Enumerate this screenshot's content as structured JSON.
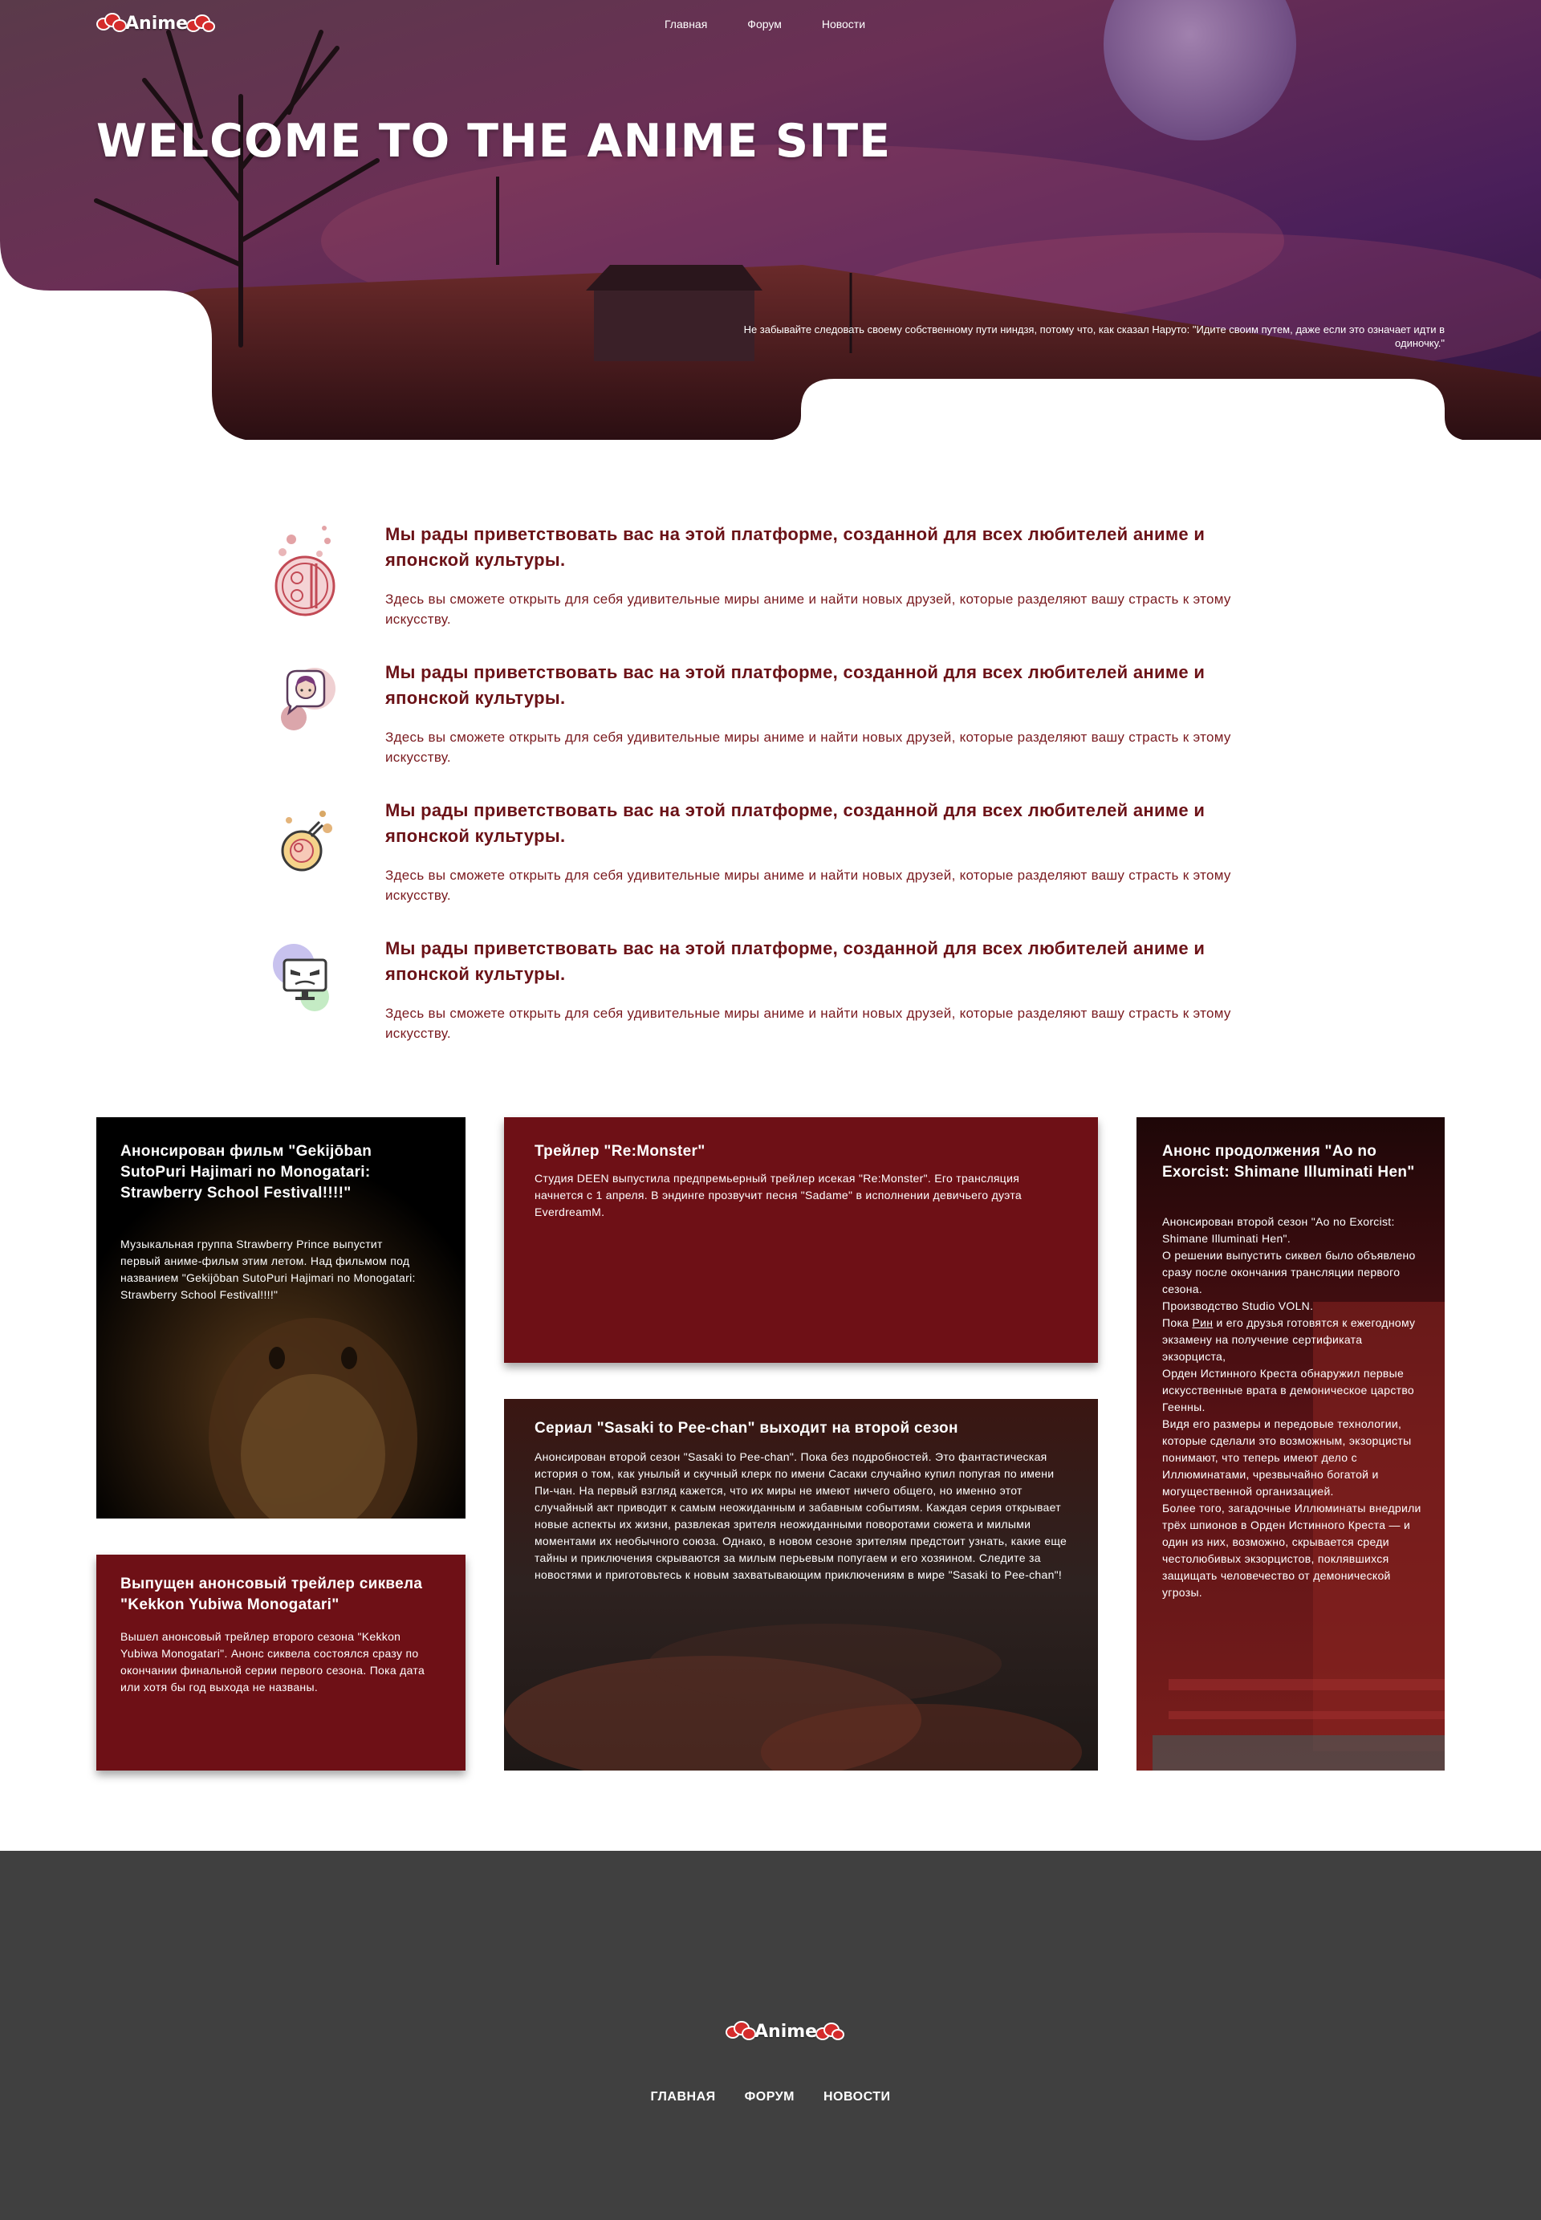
{
  "header": {
    "logo_text": "Anime",
    "nav": [
      "Главная",
      "Форум",
      "Новости"
    ]
  },
  "hero": {
    "title": "WELCOME TO THE ANIME SITE",
    "quote": "Не забывайте следовать своему собственному пути ниндзя, потому что, как сказал Наруто: \"Идите своим путем, даже если это означает идти в одиночку.\""
  },
  "features": [
    {
      "icon": "ramen-bowl-icon",
      "title": "Мы рады приветствовать вас на этой платформе, созданной для всех любителей аниме и японской культуры.",
      "text": "Здесь вы сможете открыть для себя удивительные миры аниме и найти новых друзей, которые разделяют вашу страсть к этому искусству."
    },
    {
      "icon": "anime-girl-chat-icon",
      "title": "Мы рады приветствовать вас на этой платформе, созданной для всех любителей аниме и японской культуры.",
      "text": "Здесь вы сможете открыть для себя удивительные миры аниме и найти новых друзей, которые разделяют вашу страсть к этому искусству."
    },
    {
      "icon": "noodle-cup-icon",
      "title": "Мы рады приветствовать вас на этой платформе, созданной для всех любителей аниме и японской культуры.",
      "text": "Здесь вы сможете открыть для себя удивительные миры аниме и найти новых друзей, которые разделяют вашу страсть к этому искусству."
    },
    {
      "icon": "anime-monitor-icon",
      "title": "Мы рады приветствовать вас на этой платформе, созданной для всех любителей аниме и японской культуры.",
      "text": "Здесь вы сможете открыть для себя удивительные миры аниме и найти новых друзей, которые разделяют вашу страсть к этому искусству."
    }
  ],
  "news": {
    "gekijoban": {
      "title": "Анонсирован фильм \"Gekijōban SutoPuri Hajimari no Monogatari: Strawberry School Festival!!!!\"",
      "text": "Музыкальная группа Strawberry Prince выпустит первый аниме-фильм этим летом. Над фильмом под названием \"Gekijōban SutoPuri Hajimari no Monogatari: Strawberry School Festival!!!!\""
    },
    "kekkon": {
      "title": "Выпущен анонсовый трейлер сиквела \"Kekkon Yubiwa Monogatari\"",
      "text": "Вышел анонсовый трейлер второго сезона \"Kekkon Yubiwa Monogatari\". Анонс сиквела состоялся сразу по окончании финальной серии первого сезона. Пока дата или хотя бы год выхода не названы."
    },
    "remonster": {
      "title": "Трейлер \"Re:Monster\"",
      "text": "Студия DEEN выпустила предпремьерный трейлер исекая \"Re:Monster\". Его трансляция начнется с 1 апреля. В эндинге прозвучит песня \"Sadame\" в исполнении девичьего дуэта EverdreamM."
    },
    "sasaki": {
      "title": "Сериал \"Sasaki to Pee-chan\" выходит на второй сезон",
      "text": "Анонсирован второй сезон \"Sasaki to Pee-chan\". Пока без подробностей. Это фантастическая история о том, как унылый и скучный клерк по имени Сасаки случайно купил попугая по имени Пи-чан. На первый взгляд кажется, что их миры не имеют ничего общего, но именно этот случайный акт приводит к самым неожиданным и забавным событиям. Каждая серия открывает новые аспекты их жизни, развлекая зрителя неожиданными поворотами сюжета и милыми моментами их необычного союза. Однако, в новом сезоне зрителям предстоит узнать, какие еще тайны и приключения скрываются за милым перьевым попугаем и его хозяином. Следите за новостями и приготовьтесь к новым захватывающим приключениям в мире \"Sasaki to Pee-chan\"!"
    },
    "aonoexorcist": {
      "title": "Анонс продолжения \"Ao no Exorcist: Shimane Illuminati Hen\"",
      "text_1": "Анонсирован второй сезон \"Ao no Exorcist: Shimane Illuminati Hen\".",
      "text_2": "О решении выпустить сиквел было объявлено сразу после окончания трансляции первого сезона.",
      "text_3": "Производство Studio VOLN.",
      "text_4a": "Пока ",
      "text_4link": "Рин",
      "text_4b": " и его друзья готовятся к ежегодному экзамену на получение сертификата экзорциста,",
      "text_5": "Орден Истинного Креста обнаружил первые искусственные врата в демоническое царство Геенны.",
      "text_6": "Видя его размеры и передовые технологии, которые сделали это возможным, экзорцисты понимают, что теперь имеют дело с Иллюминатами, чрезвычайно богатой и могущественной организацией.",
      "text_7": "Более того, загадочные Иллюминаты внедрили трёх шпионов в Орден Истинного Креста — и один из них, возможно, скрывается среди честолюбивых экзорцистов, поклявшихся защищать человечество от демонической угрозы."
    }
  },
  "footer": {
    "logo_text": "Anime",
    "nav": [
      "ГЛАВНАЯ",
      "ФОРУМ",
      "НОВОСТИ"
    ]
  },
  "colors": {
    "accent_red": "#6e1016",
    "text_red": "#6b1217",
    "footer_bg": "#404040"
  }
}
